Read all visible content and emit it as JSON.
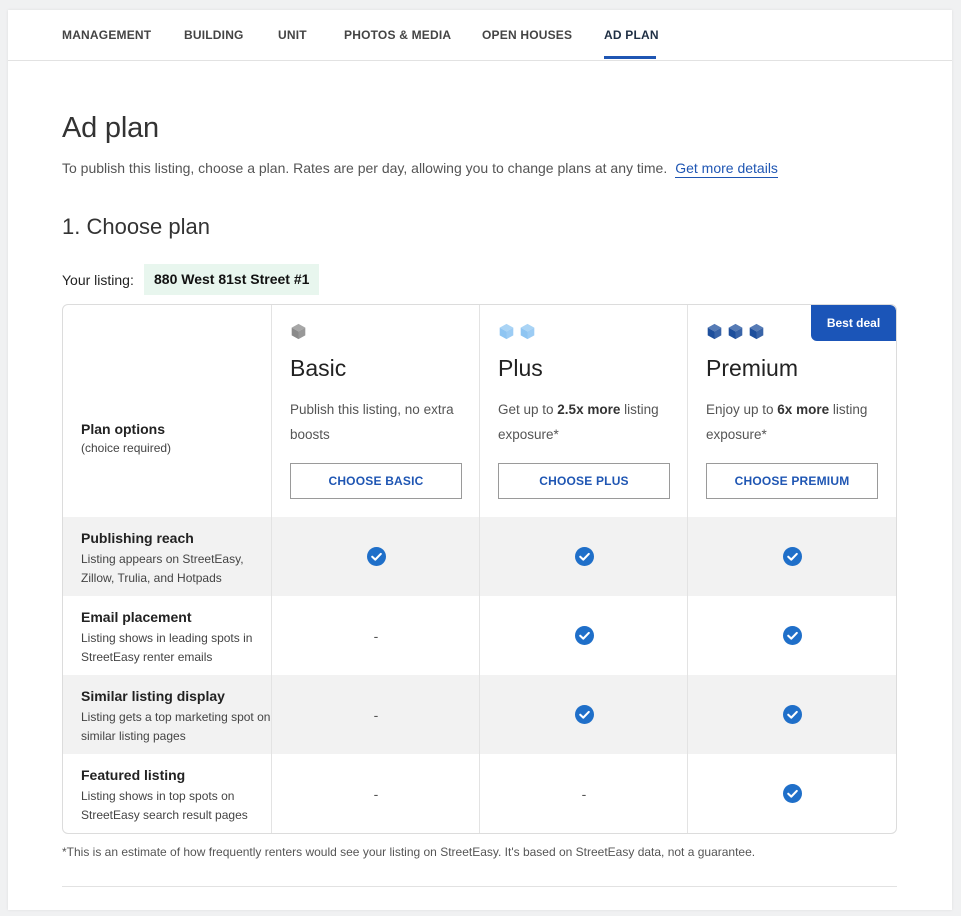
{
  "tabs": [
    {
      "label": "MANAGEMENT"
    },
    {
      "label": "BUILDING"
    },
    {
      "label": "UNIT"
    },
    {
      "label": "PHOTOS & MEDIA"
    },
    {
      "label": "OPEN HOUSES"
    },
    {
      "label": "AD PLAN",
      "active": true
    }
  ],
  "page": {
    "title": "Ad plan",
    "intro": "To publish this listing, choose a plan. Rates are per day, allowing you to change plans at any time.",
    "details_link": "Get more details",
    "section_title": "1. Choose plan",
    "listing_label": "Your listing:",
    "listing_name": "880 West 81st Street #1",
    "footnote": "*This is an estimate of how frequently renters would see your listing on StreetEasy. It's based on StreetEasy data, not a guarantee."
  },
  "options": {
    "title": "Plan options",
    "subtitle": "(choice required)"
  },
  "plans": [
    {
      "name": "Basic",
      "desc_pre": "Publish this listing, no extra boosts",
      "desc_bold": "",
      "desc_post": "",
      "button": "CHOOSE BASIC",
      "cube_icon": "cube-icon",
      "cube_count": 1,
      "cube_color": "#8a8a8a"
    },
    {
      "name": "Plus",
      "desc_pre": "Get up to ",
      "desc_bold": "2.5x more",
      "desc_post": " listing exposure*",
      "button": "CHOOSE PLUS",
      "cube_icon": "cube-icon",
      "cube_count": 2,
      "cube_color": "#8ec5f2"
    },
    {
      "name": "Premium",
      "desc_pre": "Enjoy up to ",
      "desc_bold": "6x more",
      "desc_post": " listing exposure*",
      "button": "CHOOSE PREMIUM",
      "cube_icon": "cube-icon",
      "cube_count": 3,
      "cube_color": "#1e4f9c",
      "badge": "Best deal"
    }
  ],
  "features": [
    {
      "title": "Publishing reach",
      "desc": "Listing appears on StreetEasy, Zillow, Trulia, and Hotpads",
      "values": [
        true,
        true,
        true
      ]
    },
    {
      "title": "Email placement",
      "desc": "Listing shows in leading spots in StreetEasy renter emails",
      "values": [
        false,
        true,
        true
      ]
    },
    {
      "title": "Similar listing display",
      "desc": "Listing gets a top marketing spot on similar listing pages",
      "values": [
        false,
        true,
        true
      ]
    },
    {
      "title": "Featured listing",
      "desc": "Listing shows in top spots on StreetEasy search result pages",
      "values": [
        false,
        false,
        true
      ]
    }
  ],
  "dash": "-",
  "colors": {
    "accent": "#1f56b3",
    "check": "#1f6fc9",
    "badge": "#1b55b8",
    "listing_bg": "#e8f6ee"
  }
}
